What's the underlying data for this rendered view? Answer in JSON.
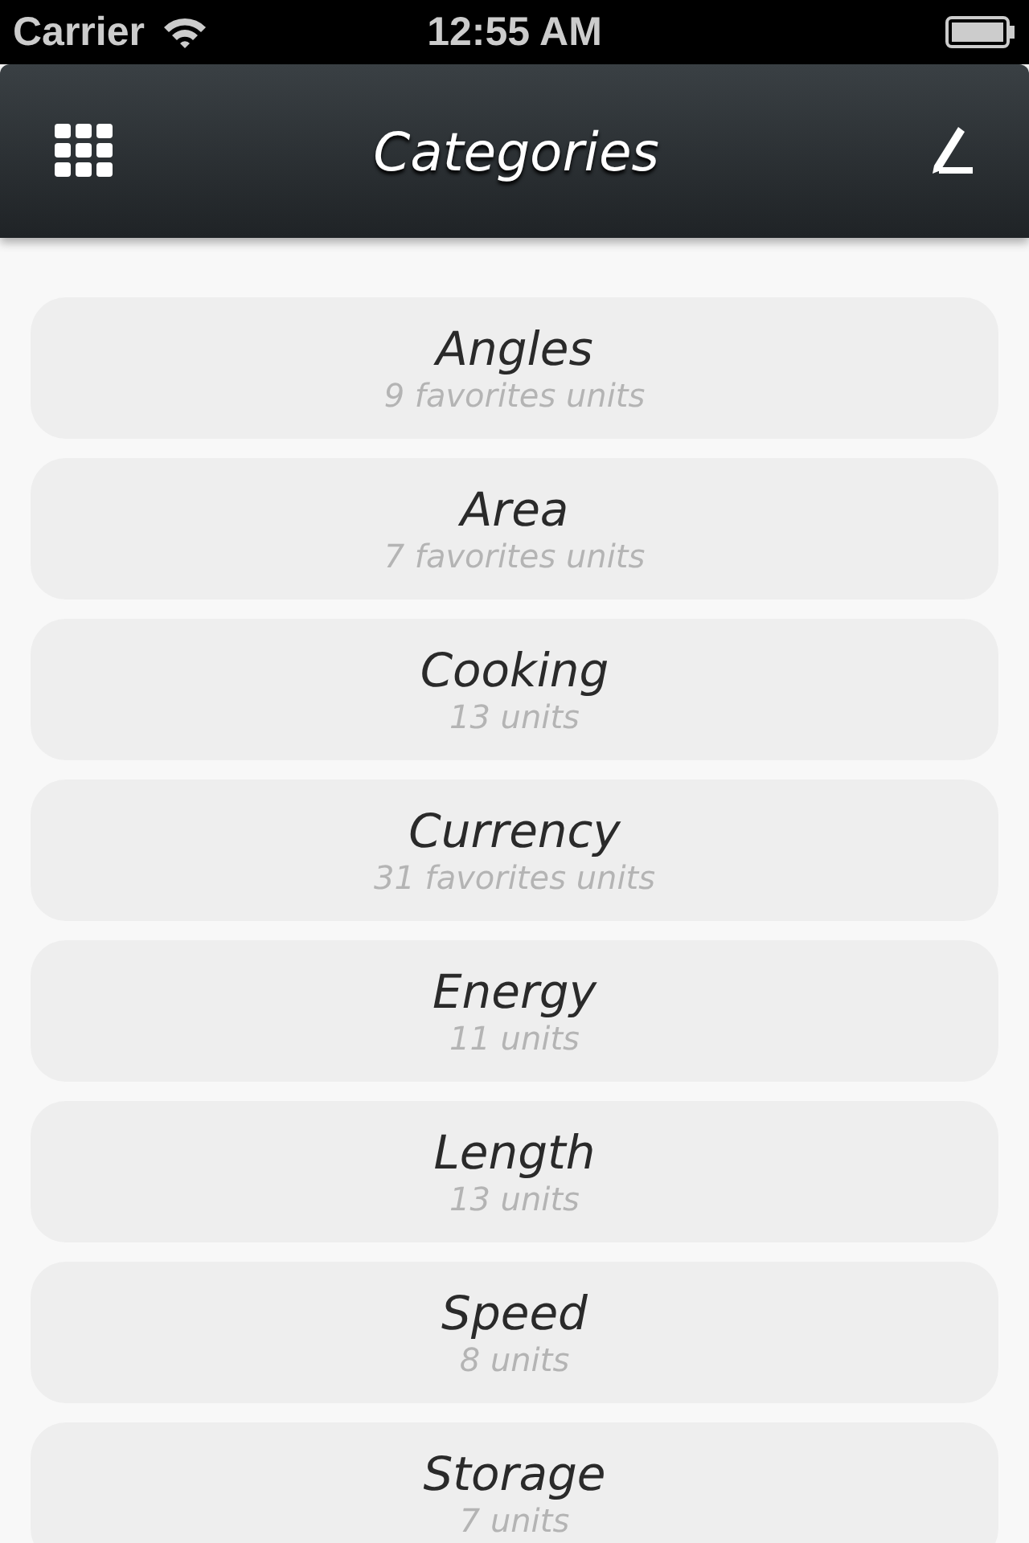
{
  "status_bar": {
    "carrier": "Carrier",
    "time": "12:55 AM"
  },
  "nav_bar": {
    "title": "Categories"
  },
  "categories": [
    {
      "name": "Angles",
      "detail": "9 favorites units"
    },
    {
      "name": "Area",
      "detail": "7 favorites units"
    },
    {
      "name": "Cooking",
      "detail": "13 units"
    },
    {
      "name": "Currency",
      "detail": "31 favorites units"
    },
    {
      "name": "Energy",
      "detail": "11 units"
    },
    {
      "name": "Length",
      "detail": "13 units"
    },
    {
      "name": "Speed",
      "detail": "8 units"
    },
    {
      "name": "Storage",
      "detail": "7 units"
    }
  ]
}
